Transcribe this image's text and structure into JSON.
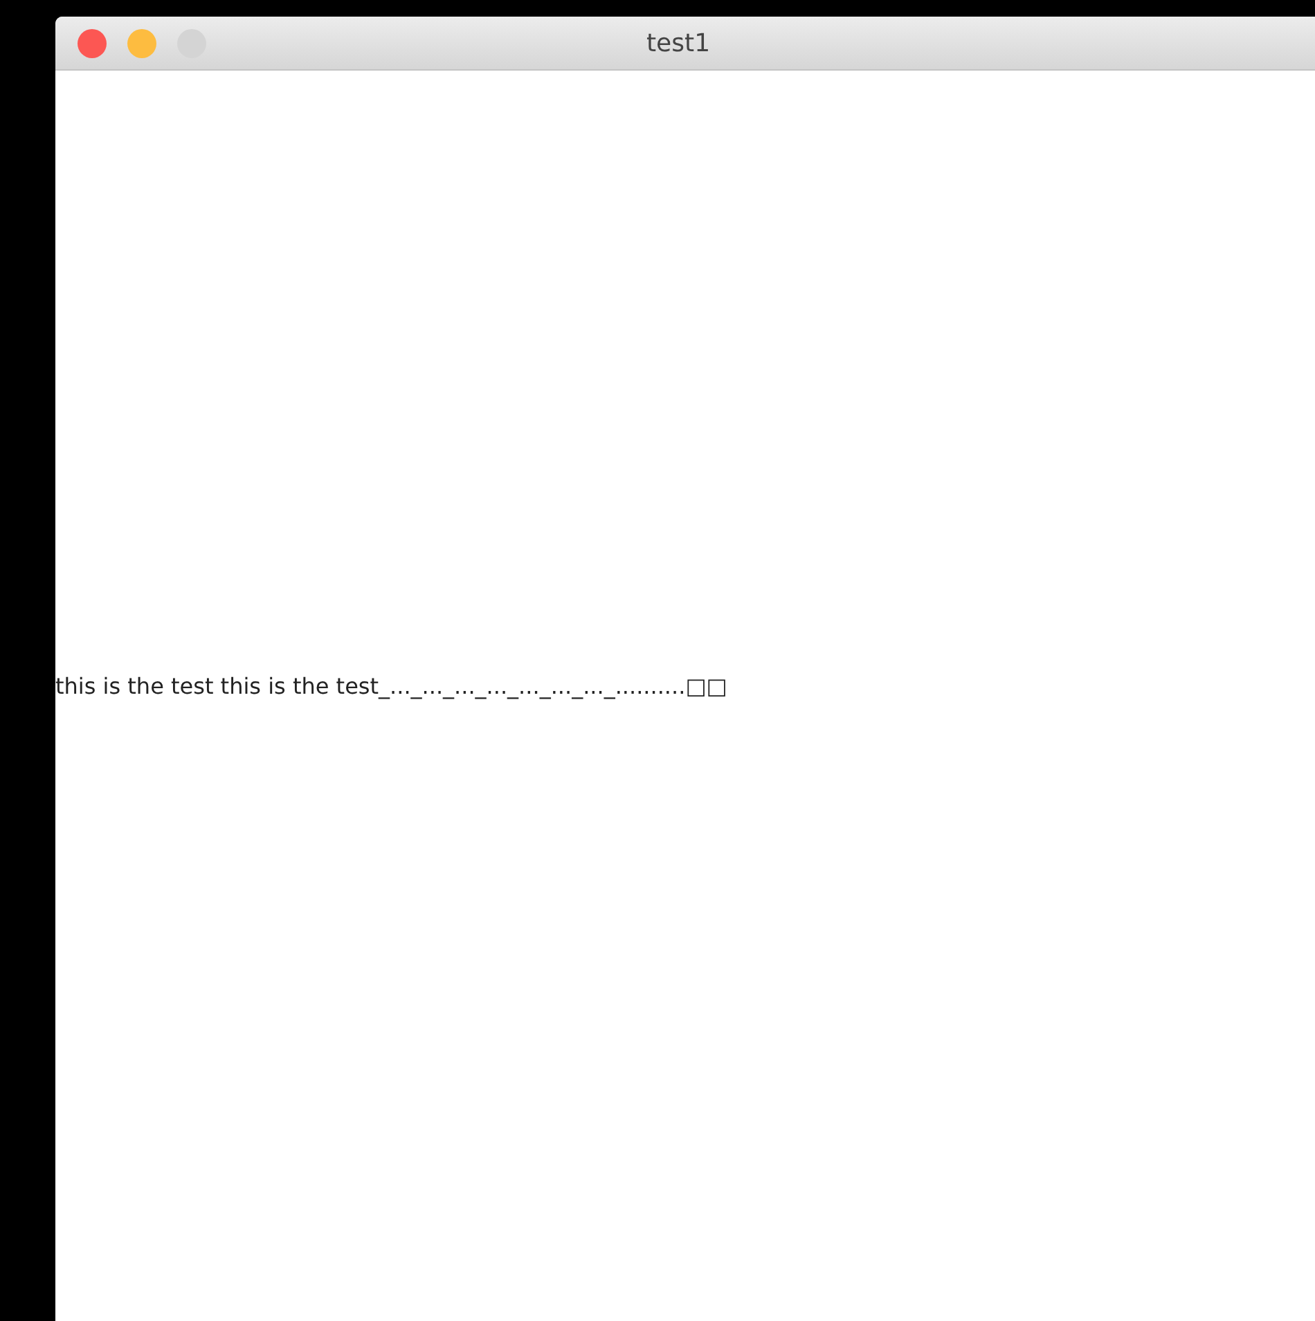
{
  "window": {
    "title": "test1",
    "buttons": [
      {
        "kind": "close"
      },
      {
        "kind": "minimize"
      },
      {
        "kind": "zoom"
      }
    ]
  },
  "content": {
    "text": "this is the test this is the test_..._..._..._..._..._..._..._..........□□"
  }
}
